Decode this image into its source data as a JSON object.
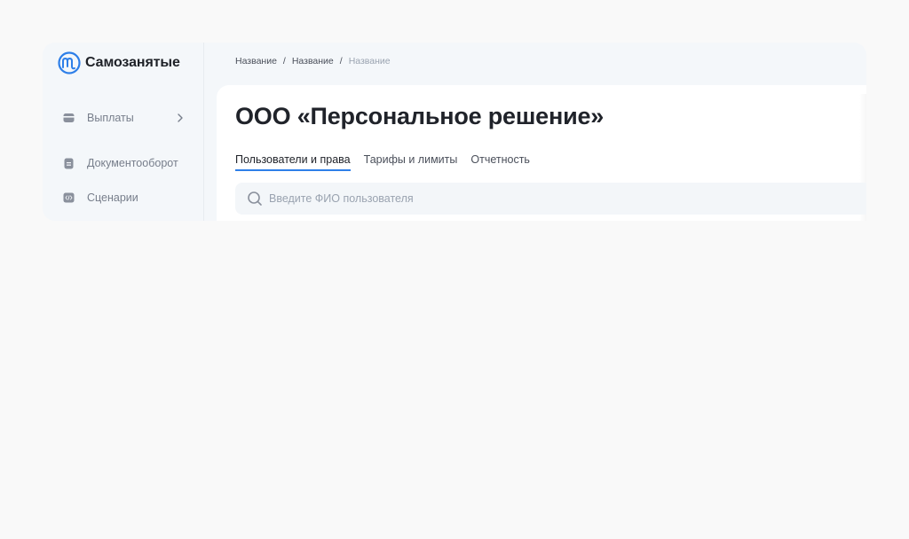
{
  "app": {
    "brand": "Самозанятые"
  },
  "sidebar": {
    "items": [
      {
        "label": "Выплаты",
        "icon": "wallet-icon"
      },
      {
        "label": "Документооборот",
        "icon": "document-icon"
      },
      {
        "label": "Сценарии",
        "icon": "code-icon"
      }
    ]
  },
  "breadcrumb": [
    "Название",
    "Название",
    "Название"
  ],
  "page": {
    "title": "ООО «Персональное решение»"
  },
  "tabs": [
    {
      "label": "Пользователи и права",
      "active": true
    },
    {
      "label": "Тарифы и лимиты",
      "active": false
    },
    {
      "label": "Отчетность",
      "active": false
    }
  ],
  "search": {
    "placeholder": "Введите ФИО пользователя",
    "value": ""
  },
  "colors": {
    "accent": "#2e7fe8",
    "icon": "#8a909c",
    "text_muted": "#777e8b"
  }
}
